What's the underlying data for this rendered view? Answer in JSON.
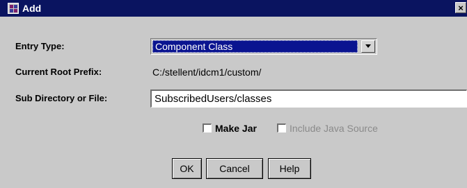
{
  "window": {
    "title": "Add",
    "close_glyph": "×",
    "app_icon": "app-icon",
    "colors": {
      "titlebar": "#0a1460",
      "face": "#c9c9c9",
      "selection": "#0a1490"
    }
  },
  "form": {
    "entry_type": {
      "label": "Entry Type:",
      "selected": "Component Class"
    },
    "root_prefix": {
      "label": "Current Root Prefix:",
      "value": "C:/stellent/idcm1/custom/"
    },
    "sub_directory": {
      "label": "Sub Directory or File:",
      "value": "SubscribedUsers/classes"
    },
    "make_jar": {
      "label": "Make Jar",
      "checked": false
    },
    "include_java_source": {
      "label": "Include Java Source",
      "checked": false,
      "enabled": false
    }
  },
  "buttons": {
    "ok": "OK",
    "cancel": "Cancel",
    "help": "Help"
  }
}
